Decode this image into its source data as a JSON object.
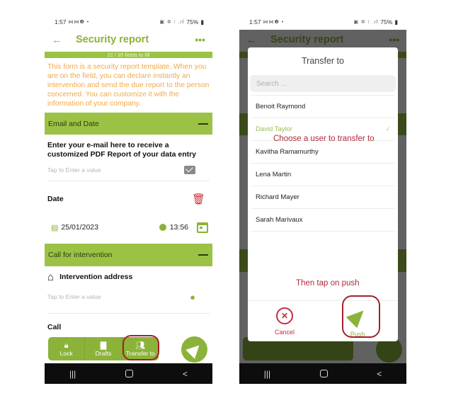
{
  "status_bar": {
    "time": "1:57",
    "left_icons": "⋈⋈❷ •",
    "right_icons": "▣ ✲ ⁝ .ıl",
    "battery": "75%"
  },
  "app_bar": {
    "title": "Security report",
    "back_icon": "←",
    "more_icon": "•••"
  },
  "progress": {
    "text": "22 / 35 fields to fill",
    "filled": 22,
    "total": 35
  },
  "intro": "This form is a security report template. When you are on the field, you can declare instantly  an  intervention and send the due report to the person concerned. You can customize it with the information of your company.",
  "sections": [
    {
      "title": "Email and Date"
    },
    {
      "title": "Call for intervention"
    }
  ],
  "email_field": {
    "label": "Enter your e-mail here to receive a customized PDF Report of your data entry",
    "placeholder": "Tap to Enter a value"
  },
  "date_field": {
    "label": "Date",
    "date": "25/01/2023",
    "time": "13:56"
  },
  "address_field": {
    "label": "Intervention address",
    "placeholder": "Tap to Enter a value"
  },
  "partial_label": "Call",
  "bottom_bar": {
    "items": [
      {
        "label": "Lock",
        "icon": "lock-icon"
      },
      {
        "label": "Drafts",
        "icon": "file-icon"
      },
      {
        "label": "Transfer to",
        "icon": "users-icon"
      }
    ]
  },
  "nav_bar": {
    "recents": "|||",
    "back": "<"
  },
  "dialog": {
    "title": "Transfer to",
    "search_placeholder": "Search ...",
    "users": [
      {
        "name": "Benoit Raymond",
        "selected": false
      },
      {
        "name": "David Taylor",
        "selected": true
      },
      {
        "name": "Kavitha Ramamurthy",
        "selected": false
      },
      {
        "name": "Lena Martin",
        "selected": false
      },
      {
        "name": "Richard Mayer",
        "selected": false
      },
      {
        "name": "Sarah Marivaux",
        "selected": false
      }
    ],
    "cancel_label": "Cancel",
    "push_label": "Push",
    "check_icon": "✓"
  },
  "annotations": {
    "choose": "Choose a user to transfer to",
    "then": "Then tap on push"
  },
  "colors": {
    "brand_green": "#8bb33a",
    "section_green": "#9bc244",
    "intro_orange": "#f0a948",
    "danger_red": "#d42a36",
    "annotation_red": "#b2293a"
  }
}
